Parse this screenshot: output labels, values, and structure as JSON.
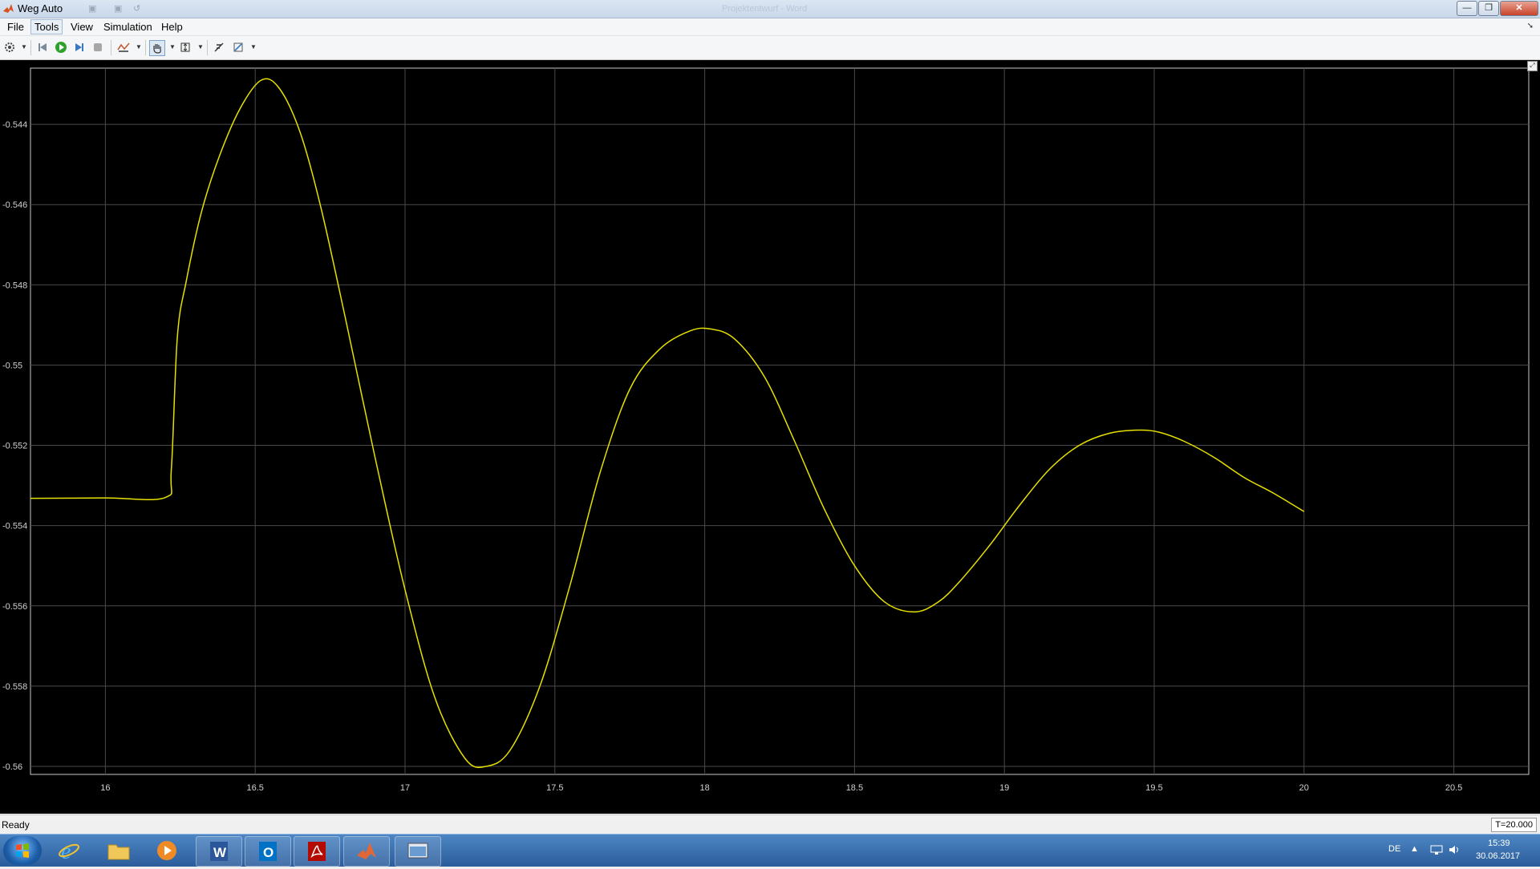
{
  "window": {
    "title": "Weg Auto",
    "ghost_title": "Projektentwurf - Word",
    "minimize_glyph": "—",
    "maximize_glyph": "❐",
    "close_glyph": "✕"
  },
  "menu": {
    "items": [
      "File",
      "Tools",
      "View",
      "Simulation",
      "Help"
    ],
    "active": "Tools"
  },
  "toolbar": {
    "icons": [
      "gear-icon",
      "step-back-icon",
      "run-icon",
      "step-forward-icon",
      "stop-icon",
      "signal-style-icon",
      "pan-hand-icon",
      "zoom-fit-icon",
      "data-cursor-icon",
      "highlight-icon"
    ]
  },
  "plot": {
    "background": "#000000",
    "line_color": "#e6e000",
    "grid_color": "#4a4a4a"
  },
  "chart_data": {
    "type": "line",
    "title": "",
    "xlabel": "",
    "ylabel": "",
    "xlim": [
      15.75,
      20.75
    ],
    "ylim": [
      -0.5602,
      -0.5426
    ],
    "x_ticks": [
      "16",
      "16.5",
      "17",
      "17.5",
      "18",
      "18.5",
      "19",
      "19.5",
      "20",
      "20.5"
    ],
    "y_ticks": [
      "-0.544",
      "-0.546",
      "-0.548",
      "-0.55",
      "-0.552",
      "-0.554",
      "-0.556",
      "-0.558",
      "-0.56"
    ],
    "grid": true,
    "series": [
      {
        "x": [
          15.75,
          16.0,
          16.2,
          16.22,
          16.24,
          16.27,
          16.32,
          16.38,
          16.45,
          16.52,
          16.58,
          16.65,
          16.72,
          16.8,
          16.9,
          17.0,
          17.1,
          17.2,
          17.27,
          17.35,
          17.45,
          17.55,
          17.65,
          17.75,
          17.85,
          17.95,
          18.02,
          18.1,
          18.2,
          18.3,
          18.4,
          18.5,
          18.6,
          18.7,
          18.78,
          18.85,
          18.95,
          19.05,
          19.15,
          19.25,
          19.35,
          19.45,
          19.52,
          19.6,
          19.7,
          19.8,
          19.9,
          20.0
        ],
        "y": [
          -0.55332,
          -0.55331,
          -0.5533,
          -0.5526,
          -0.5493,
          -0.5479,
          -0.5462,
          -0.5448,
          -0.5436,
          -0.5429,
          -0.5431,
          -0.5442,
          -0.5461,
          -0.5488,
          -0.5523,
          -0.5556,
          -0.5583,
          -0.5598,
          -0.56,
          -0.5596,
          -0.558,
          -0.5555,
          -0.5527,
          -0.5506,
          -0.5496,
          -0.54915,
          -0.5491,
          -0.54935,
          -0.5503,
          -0.5519,
          -0.5536,
          -0.555,
          -0.5559,
          -0.55615,
          -0.5559,
          -0.5554,
          -0.5545,
          -0.5535,
          -0.5526,
          -0.552,
          -0.5517,
          -0.55162,
          -0.55168,
          -0.5519,
          -0.5523,
          -0.5528,
          -0.5532,
          -0.55365
        ]
      }
    ]
  },
  "status": {
    "text": "Ready",
    "time": "T=20.000"
  },
  "taskbar": {
    "apps": [
      "internet-explorer-icon",
      "file-explorer-icon",
      "media-player-icon",
      "word-icon",
      "outlook-icon",
      "acrobat-icon",
      "matlab-icon",
      "scope-window-icon"
    ],
    "language": "DE",
    "clock_time": "15:39",
    "clock_date": "30.06.2017"
  }
}
